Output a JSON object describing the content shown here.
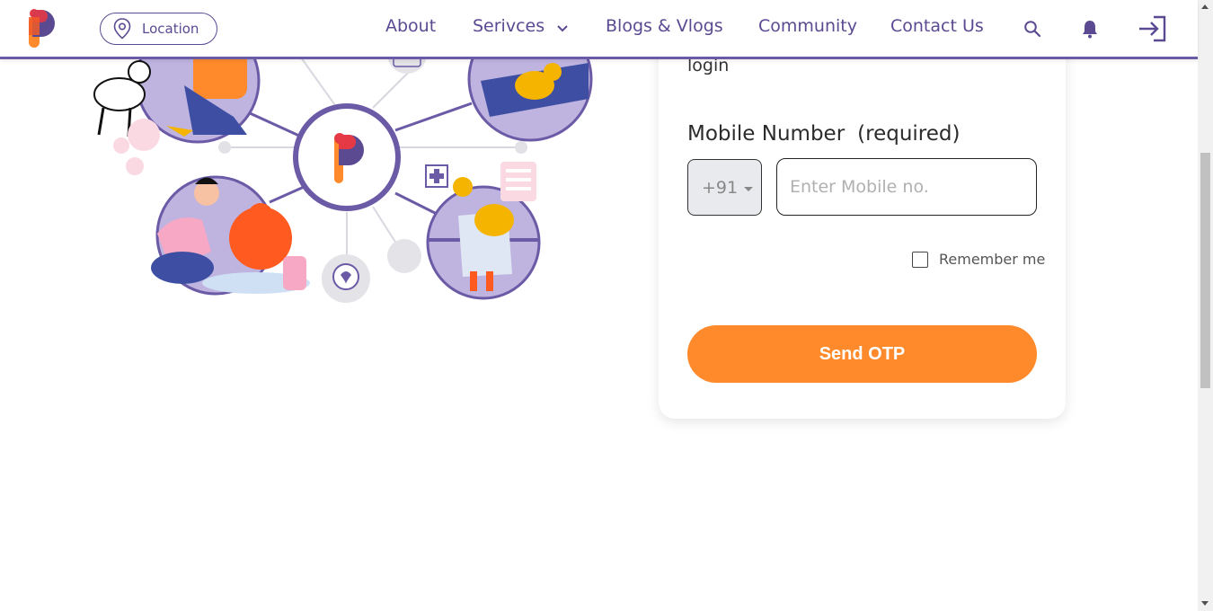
{
  "header": {
    "location_label": "Location",
    "nav": {
      "about": "About",
      "services": "Serivces",
      "blogs": "Blogs & Vlogs",
      "community": "Community",
      "contact": "Contact Us"
    },
    "icons": {
      "location": "map-pin-icon",
      "services_dropdown": "chevron-down-icon",
      "search": "search-icon",
      "notifications": "bell-icon",
      "login": "login-icon"
    }
  },
  "colors": {
    "brand_purple": "#5b4a92",
    "accent_orange": "#ff8a2b",
    "logo_red": "#e63946",
    "logo_orange": "#ff8a2b"
  },
  "card": {
    "intro_text": "login",
    "mobile_label": "Mobile Number",
    "mobile_required": "(required)",
    "country_code": "+91",
    "mobile_placeholder": "Enter Mobile no.",
    "remember_label": "Remember me",
    "remember_checked": false,
    "send_button": "Send OTP"
  }
}
